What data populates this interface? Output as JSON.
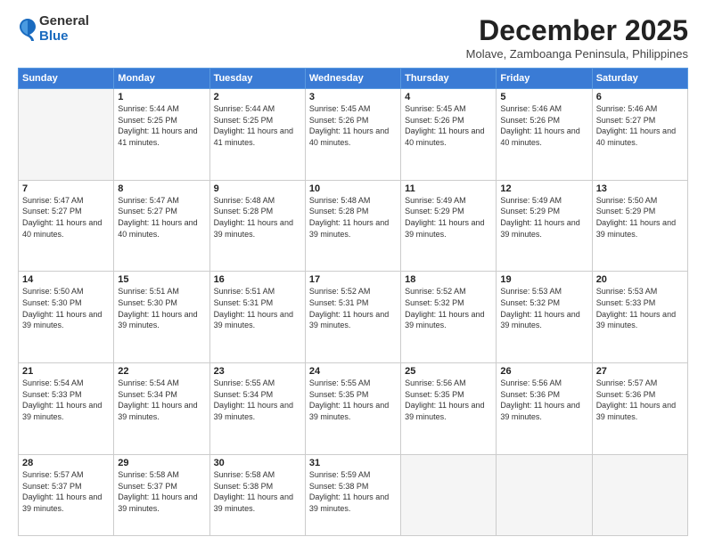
{
  "logo": {
    "general": "General",
    "blue": "Blue"
  },
  "header": {
    "month": "December 2025",
    "location": "Molave, Zamboanga Peninsula, Philippines"
  },
  "weekdays": [
    "Sunday",
    "Monday",
    "Tuesday",
    "Wednesday",
    "Thursday",
    "Friday",
    "Saturday"
  ],
  "weeks": [
    [
      {
        "day": "",
        "empty": true
      },
      {
        "day": "1",
        "sunrise": "5:44 AM",
        "sunset": "5:25 PM",
        "daylight": "11 hours and 41 minutes."
      },
      {
        "day": "2",
        "sunrise": "5:44 AM",
        "sunset": "5:25 PM",
        "daylight": "11 hours and 41 minutes."
      },
      {
        "day": "3",
        "sunrise": "5:45 AM",
        "sunset": "5:26 PM",
        "daylight": "11 hours and 40 minutes."
      },
      {
        "day": "4",
        "sunrise": "5:45 AM",
        "sunset": "5:26 PM",
        "daylight": "11 hours and 40 minutes."
      },
      {
        "day": "5",
        "sunrise": "5:46 AM",
        "sunset": "5:26 PM",
        "daylight": "11 hours and 40 minutes."
      },
      {
        "day": "6",
        "sunrise": "5:46 AM",
        "sunset": "5:27 PM",
        "daylight": "11 hours and 40 minutes."
      }
    ],
    [
      {
        "day": "7",
        "sunrise": "5:47 AM",
        "sunset": "5:27 PM",
        "daylight": "11 hours and 40 minutes."
      },
      {
        "day": "8",
        "sunrise": "5:47 AM",
        "sunset": "5:27 PM",
        "daylight": "11 hours and 40 minutes."
      },
      {
        "day": "9",
        "sunrise": "5:48 AM",
        "sunset": "5:28 PM",
        "daylight": "11 hours and 39 minutes."
      },
      {
        "day": "10",
        "sunrise": "5:48 AM",
        "sunset": "5:28 PM",
        "daylight": "11 hours and 39 minutes."
      },
      {
        "day": "11",
        "sunrise": "5:49 AM",
        "sunset": "5:29 PM",
        "daylight": "11 hours and 39 minutes."
      },
      {
        "day": "12",
        "sunrise": "5:49 AM",
        "sunset": "5:29 PM",
        "daylight": "11 hours and 39 minutes."
      },
      {
        "day": "13",
        "sunrise": "5:50 AM",
        "sunset": "5:29 PM",
        "daylight": "11 hours and 39 minutes."
      }
    ],
    [
      {
        "day": "14",
        "sunrise": "5:50 AM",
        "sunset": "5:30 PM",
        "daylight": "11 hours and 39 minutes."
      },
      {
        "day": "15",
        "sunrise": "5:51 AM",
        "sunset": "5:30 PM",
        "daylight": "11 hours and 39 minutes."
      },
      {
        "day": "16",
        "sunrise": "5:51 AM",
        "sunset": "5:31 PM",
        "daylight": "11 hours and 39 minutes."
      },
      {
        "day": "17",
        "sunrise": "5:52 AM",
        "sunset": "5:31 PM",
        "daylight": "11 hours and 39 minutes."
      },
      {
        "day": "18",
        "sunrise": "5:52 AM",
        "sunset": "5:32 PM",
        "daylight": "11 hours and 39 minutes."
      },
      {
        "day": "19",
        "sunrise": "5:53 AM",
        "sunset": "5:32 PM",
        "daylight": "11 hours and 39 minutes."
      },
      {
        "day": "20",
        "sunrise": "5:53 AM",
        "sunset": "5:33 PM",
        "daylight": "11 hours and 39 minutes."
      }
    ],
    [
      {
        "day": "21",
        "sunrise": "5:54 AM",
        "sunset": "5:33 PM",
        "daylight": "11 hours and 39 minutes."
      },
      {
        "day": "22",
        "sunrise": "5:54 AM",
        "sunset": "5:34 PM",
        "daylight": "11 hours and 39 minutes."
      },
      {
        "day": "23",
        "sunrise": "5:55 AM",
        "sunset": "5:34 PM",
        "daylight": "11 hours and 39 minutes."
      },
      {
        "day": "24",
        "sunrise": "5:55 AM",
        "sunset": "5:35 PM",
        "daylight": "11 hours and 39 minutes."
      },
      {
        "day": "25",
        "sunrise": "5:56 AM",
        "sunset": "5:35 PM",
        "daylight": "11 hours and 39 minutes."
      },
      {
        "day": "26",
        "sunrise": "5:56 AM",
        "sunset": "5:36 PM",
        "daylight": "11 hours and 39 minutes."
      },
      {
        "day": "27",
        "sunrise": "5:57 AM",
        "sunset": "5:36 PM",
        "daylight": "11 hours and 39 minutes."
      }
    ],
    [
      {
        "day": "28",
        "sunrise": "5:57 AM",
        "sunset": "5:37 PM",
        "daylight": "11 hours and 39 minutes."
      },
      {
        "day": "29",
        "sunrise": "5:58 AM",
        "sunset": "5:37 PM",
        "daylight": "11 hours and 39 minutes."
      },
      {
        "day": "30",
        "sunrise": "5:58 AM",
        "sunset": "5:38 PM",
        "daylight": "11 hours and 39 minutes."
      },
      {
        "day": "31",
        "sunrise": "5:59 AM",
        "sunset": "5:38 PM",
        "daylight": "11 hours and 39 minutes."
      },
      {
        "day": "",
        "empty": true
      },
      {
        "day": "",
        "empty": true
      },
      {
        "day": "",
        "empty": true
      }
    ]
  ],
  "labels": {
    "sunrise": "Sunrise:",
    "sunset": "Sunset:",
    "daylight": "Daylight:"
  }
}
